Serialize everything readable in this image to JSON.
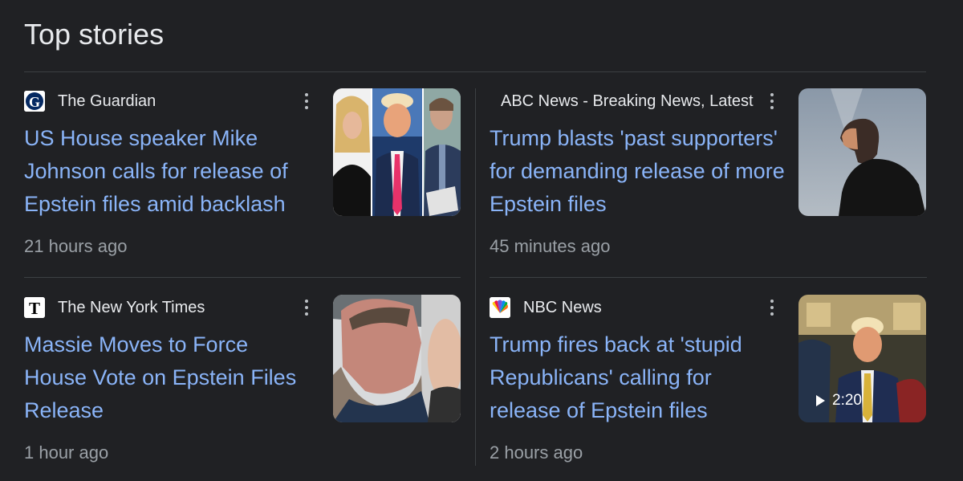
{
  "section": {
    "title": "Top stories"
  },
  "colors": {
    "background": "#202124",
    "headline": "#8ab4f8",
    "source_text": "#e8eaed",
    "timestamp": "#9aa0a6",
    "divider": "#3c4043"
  },
  "stories": [
    {
      "source": "The Guardian",
      "favicon_icon": "guardian-logo-icon",
      "headline": "US House speaker Mike Johnson calls for release of Epstein files amid backlash",
      "time": "21 hours ago",
      "thumbnail": "three-person-news-photo"
    },
    {
      "source": "ABC News - Breaking News, Latest",
      "favicon_icon": "none",
      "headline": "Trump blasts 'past supporters' for demanding release of more Epstein files",
      "time": "45 minutes ago",
      "thumbnail": "man-silhouette-photo"
    },
    {
      "source": "The New York Times",
      "favicon_icon": "nyt-logo-icon",
      "headline": "Massie Moves to Force House Vote on Epstein Files Release",
      "time": "1 hour ago",
      "thumbnail": "man-closeup-photo"
    },
    {
      "source": "NBC News",
      "favicon_icon": "nbc-peacock-icon",
      "headline": "Trump fires back at 'stupid Republicans' calling for release of Epstein files",
      "time": "2 hours ago",
      "thumbnail": "oval-office-video-thumbnail",
      "video_duration": "2:20"
    }
  ]
}
